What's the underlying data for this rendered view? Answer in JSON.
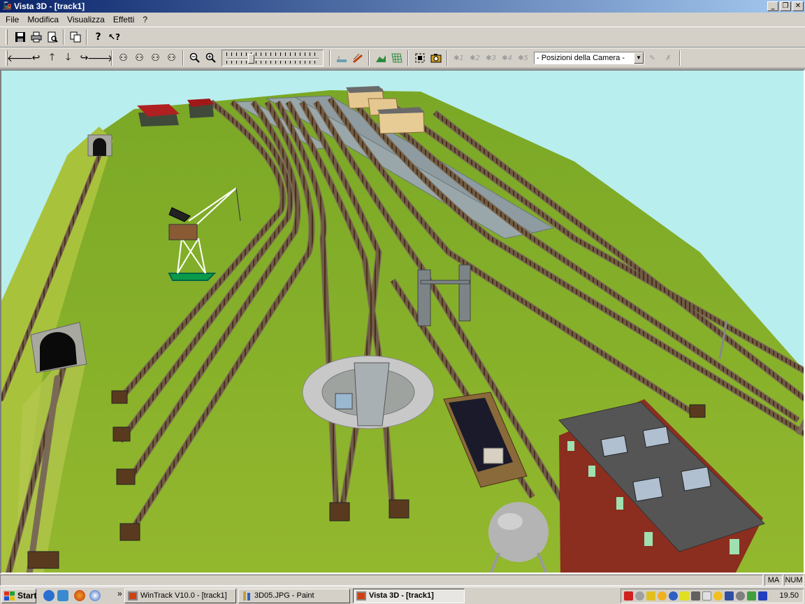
{
  "window": {
    "title": "Vista 3D - [track1]",
    "buttons": {
      "minimize": "_",
      "maximize": "❐",
      "close": "✕"
    }
  },
  "menu": [
    "File",
    "Modifica",
    "Visualizza",
    "Effetti",
    "?"
  ],
  "toolbar1": {
    "buttons": [
      "save-icon",
      "print-icon",
      "print-preview-icon",
      "copy-icon",
      "help-icon",
      "context-help-icon"
    ]
  },
  "toolbar2": {
    "nav_buttons": [
      "arrow-left-icon",
      "rotate-left-icon",
      "arrow-up-icon",
      "arrow-down-icon",
      "rotate-right-icon",
      "arrow-right-icon"
    ],
    "walk_buttons": [
      "walk-forward-icon",
      "walk-left-icon",
      "walk-right-icon",
      "walk-back-icon"
    ],
    "zoom_buttons": [
      "zoom-out-icon",
      "zoom-in-icon"
    ],
    "slider_level": 0.25,
    "tool_buttons": [
      "terrain-icon",
      "track-tool-icon",
      "landscape-icon",
      "grid-icon",
      "fit-view-icon",
      "camera-icon"
    ],
    "camera_slots": [
      "1",
      "2",
      "3",
      "4",
      "5"
    ],
    "camera_select": "- Posizioni della Camera -",
    "edit_buttons": [
      "edit-camera-icon",
      "delete-camera-icon"
    ]
  },
  "status": {
    "caps": "MA",
    "num": "NUM"
  },
  "taskbar": {
    "start": "Start",
    "chevron": "»",
    "tasks": [
      {
        "label": "WinTrack  V10.0 - [track1]",
        "active": false
      },
      {
        "label": "3D05.JPG - Paint",
        "active": false
      },
      {
        "label": "Vista 3D - [track1]",
        "active": true
      }
    ],
    "clock": "19.50"
  },
  "colors": {
    "sky": "#b9eeee",
    "grass": "#8fb52a",
    "track": "#7a6a55",
    "sleeper": "#5a3a1e",
    "platform": "#9aa7aa",
    "roof": "#555555",
    "brick": "#8b2e1f",
    "titlebar": "#0a246a"
  }
}
